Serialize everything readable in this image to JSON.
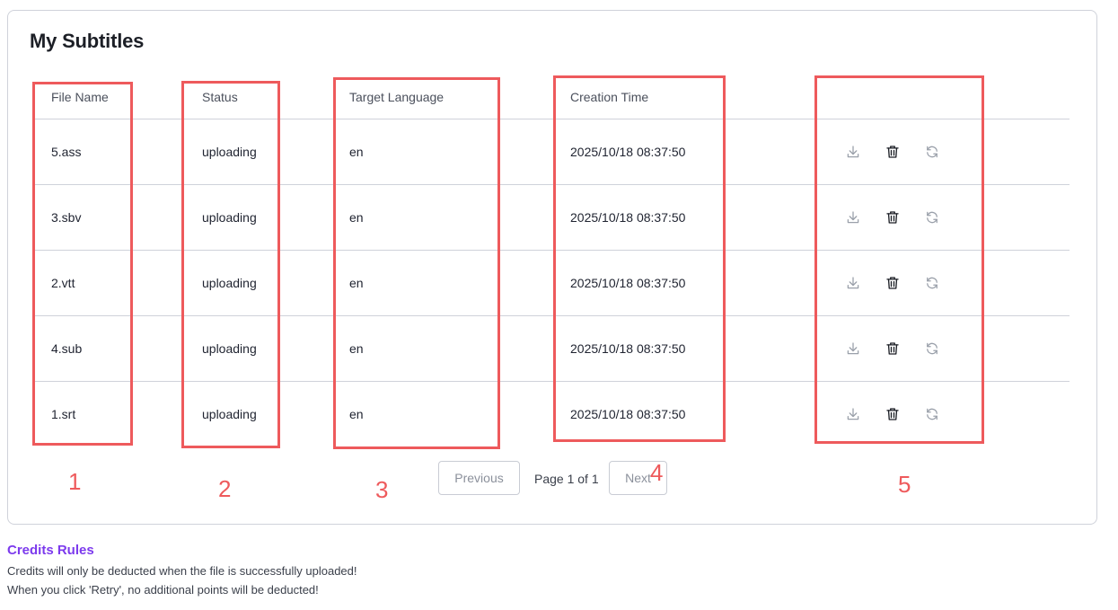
{
  "page_title": "My Subtitles",
  "columns": [
    "File Name",
    "Status",
    "Target Language",
    "Creation Time"
  ],
  "rows": [
    {
      "file_name": "5.ass",
      "status": "uploading",
      "language": "en",
      "created": "2025/10/18 08:37:50"
    },
    {
      "file_name": "3.sbv",
      "status": "uploading",
      "language": "en",
      "created": "2025/10/18 08:37:50"
    },
    {
      "file_name": "2.vtt",
      "status": "uploading",
      "language": "en",
      "created": "2025/10/18 08:37:50"
    },
    {
      "file_name": "4.sub",
      "status": "uploading",
      "language": "en",
      "created": "2025/10/18 08:37:50"
    },
    {
      "file_name": "1.srt",
      "status": "uploading",
      "language": "en",
      "created": "2025/10/18 08:37:50"
    }
  ],
  "row_actions": [
    "download-icon",
    "trash-icon",
    "refresh-icon"
  ],
  "pagination": {
    "previous": "Previous",
    "page_info": "Page 1 of 1",
    "next": "Next"
  },
  "annotations": [
    "1",
    "2",
    "3",
    "4",
    "5"
  ],
  "credits": {
    "title": "Credits Rules",
    "lines": [
      "Credits will only be deducted when the file is successfully uploaded!",
      "When you click 'Retry', no additional points will be deducted!"
    ]
  },
  "colors": {
    "accent": "#7c3aed",
    "annotation": "#ee5a5c",
    "border": "#cfd2da"
  }
}
